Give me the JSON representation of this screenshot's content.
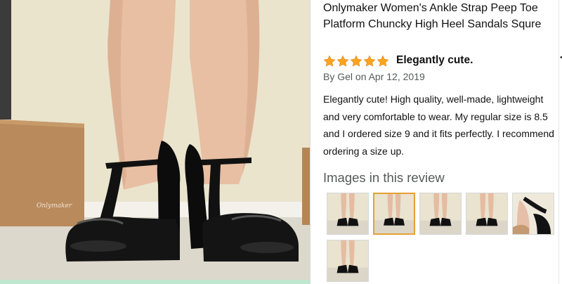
{
  "product": {
    "title": "Onlymaker Women's Ankle Strap Peep Toe\nPlatform Chuncky High Heel Sandals Squre"
  },
  "review": {
    "rating": 5,
    "rating_max": 5,
    "title": "Elegantly cute.",
    "byline": "By Gel on Apr 12, 2019",
    "body": "Elegantly cute! High quality, well-made, lightweight and very comfortable to wear. My regular size is 8.5 and I ordered size 9 and it fits perfectly. I recommend ordering a size up."
  },
  "images_section": {
    "heading": "Images in this review",
    "selected_index": 1,
    "thumbnails": [
      {
        "name": "review-thumbnail-1"
      },
      {
        "name": "review-thumbnail-2"
      },
      {
        "name": "review-thumbnail-3"
      },
      {
        "name": "review-thumbnail-4"
      },
      {
        "name": "review-thumbnail-5"
      },
      {
        "name": "review-thumbnail-6"
      }
    ]
  },
  "main_image": {
    "box_brand": "Onlymaker"
  },
  "colors": {
    "star": "#ffa41c",
    "selected_border": "#e5a135",
    "text": "#111111",
    "muted": "#565959"
  }
}
